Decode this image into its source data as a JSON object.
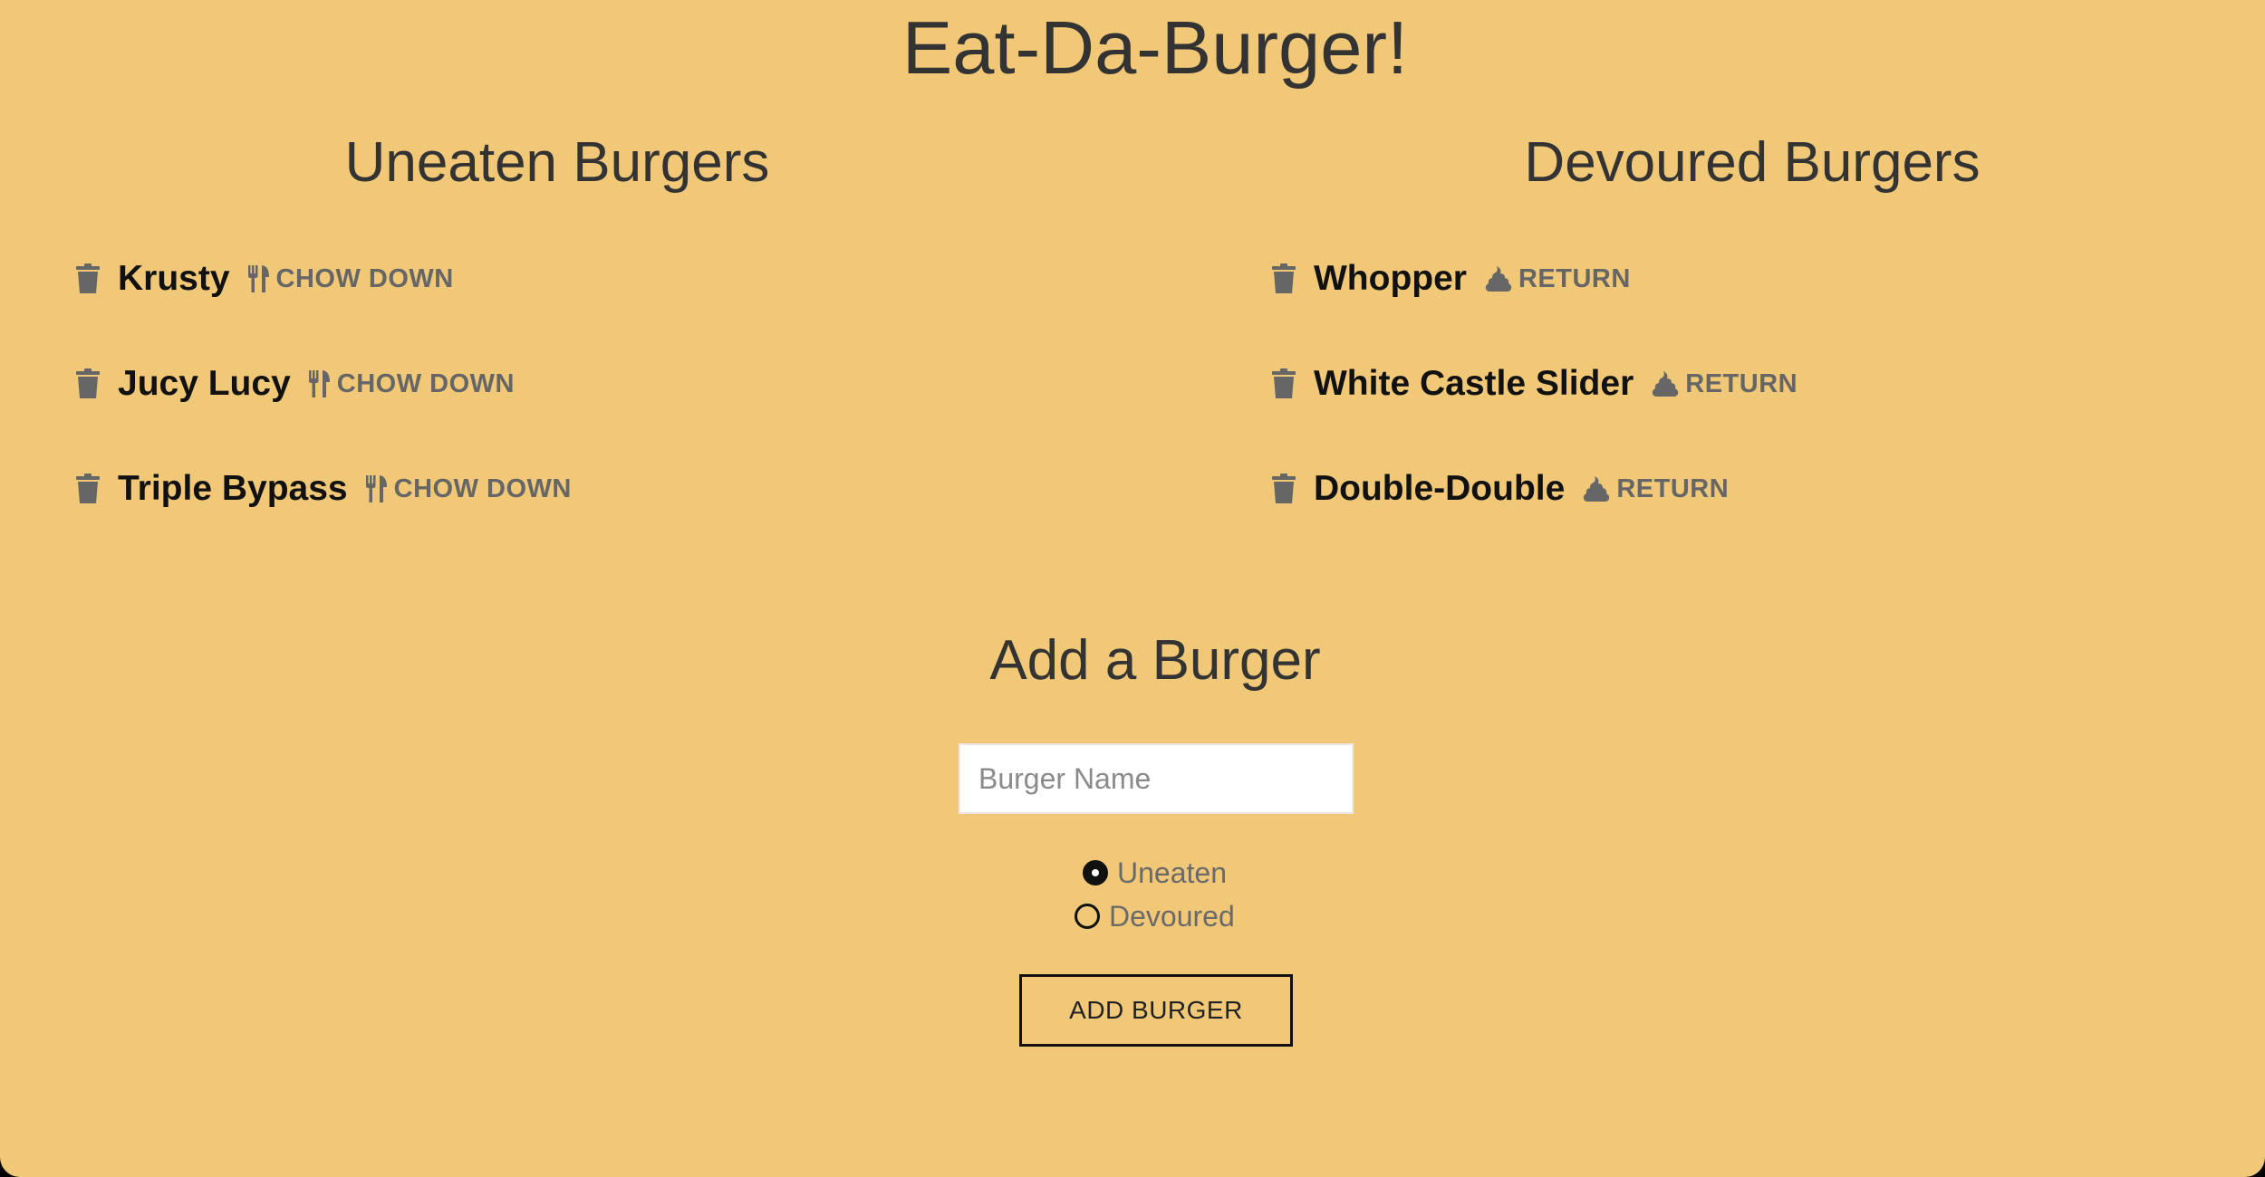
{
  "app": {
    "title": "Eat-Da-Burger!"
  },
  "uneaten": {
    "title": "Uneaten Burgers",
    "action_icon": "fork-knife-icon",
    "items": [
      {
        "name": "Krusty",
        "action": "CHOW DOWN"
      },
      {
        "name": "Jucy Lucy",
        "action": "CHOW DOWN"
      },
      {
        "name": "Triple Bypass",
        "action": "CHOW DOWN"
      }
    ]
  },
  "devoured": {
    "title": "Devoured Burgers",
    "action_icon": "poop-icon",
    "items": [
      {
        "name": "Whopper",
        "action": "RETURN"
      },
      {
        "name": "White Castle Slider",
        "action": "RETURN"
      },
      {
        "name": "Double-Double",
        "action": "RETURN"
      }
    ]
  },
  "form": {
    "title": "Add a Burger",
    "name_placeholder": "Burger Name",
    "name_value": "",
    "options": [
      {
        "label": "Uneaten",
        "checked": true
      },
      {
        "label": "Devoured",
        "checked": false
      }
    ],
    "submit_label": "ADD BURGER"
  },
  "colors": {
    "background": "#f0c877",
    "text": "#333333",
    "icon": "#666666"
  }
}
